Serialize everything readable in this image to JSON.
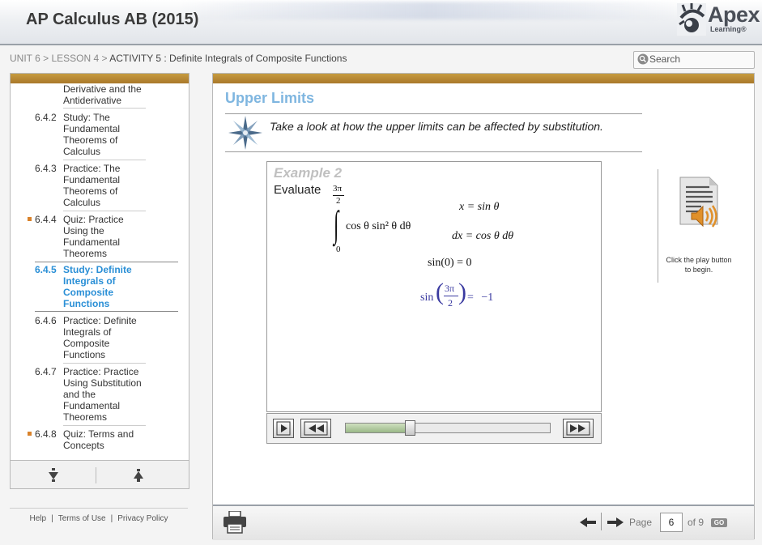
{
  "header": {
    "app_title": "AP Calculus AB (2015)",
    "logo": {
      "name": "Apex",
      "sub": "Learning®",
      "icon": "apex-sun-icon"
    }
  },
  "breadcrumb": {
    "unit": "UNIT 6",
    "lesson": "LESSON 4",
    "activity": "ACTIVITY 5 : Definite Integrals of Composite Functions",
    "separator": ">"
  },
  "search": {
    "placeholder": "Search",
    "value": "",
    "icon": "search-icon"
  },
  "sidebar": {
    "items": [
      {
        "number": "",
        "label": "Derivative and the Antiderivative",
        "bullet": false,
        "active": false
      },
      {
        "number": "6.4.2",
        "label": "Study: The Fundamental Theorems of Calculus",
        "bullet": false,
        "active": false
      },
      {
        "number": "6.4.3",
        "label": "Practice: The Fundamental Theorems of Calculus",
        "bullet": false,
        "active": false
      },
      {
        "number": "6.4.4",
        "label": "Quiz: Practice Using the Fundamental Theorems",
        "bullet": true,
        "active": false
      },
      {
        "number": "6.4.5",
        "label": "Study: Definite Integrals of Composite Functions",
        "bullet": false,
        "active": true
      },
      {
        "number": "6.4.6",
        "label": "Practice: Definite Integrals of Composite Functions",
        "bullet": false,
        "active": false
      },
      {
        "number": "6.4.7",
        "label": "Practice: Practice Using Substitution and the Fundamental Theorems",
        "bullet": false,
        "active": false
      },
      {
        "number": "6.4.8",
        "label": "Quiz: Terms and Concepts",
        "bullet": true,
        "active": false
      }
    ],
    "scroll_down_icon": "arrow-down-icon",
    "scroll_up_icon": "arrow-up-icon"
  },
  "footer_links": {
    "help": "Help",
    "terms": "Terms of Use",
    "privacy": "Privacy Policy"
  },
  "main": {
    "heading": "Upper Limits",
    "intro": "Take a look at how the upper limits can be affected by substitution.",
    "example": {
      "title": "Example 2",
      "evaluate": "Evaluate",
      "upper_limit_num": "3π",
      "upper_limit_den": "2",
      "lower_limit": "0",
      "integrand": "cos θ sin² θ dθ",
      "line1": "x = sin θ",
      "line2": "dx = cos θ dθ",
      "line3": "sin(0) = 0",
      "line4_fn": "sin",
      "line4_num": "3π",
      "line4_den": "2",
      "line4_rhs": "= −1"
    },
    "player": {
      "play_icon": "play-icon",
      "rewind_icon": "rewind-icon",
      "forward_icon": "fast-forward-icon",
      "progress": 0.31
    },
    "audio": {
      "icon": "audio-document-icon",
      "hint": "Click the play button to begin."
    },
    "pager": {
      "print_icon": "printer-icon",
      "prev_icon": "prev-page-icon",
      "next_icon": "next-page-icon",
      "page_label": "Page",
      "current_page": "6",
      "total": "of 9",
      "go_label": "GO"
    }
  },
  "colors": {
    "accent_bar": "#b8893a",
    "active_link": "#2a8fd6",
    "heading": "#7fb6e0",
    "bullet": "#d9822b",
    "math_blue": "#3a3aa0"
  }
}
